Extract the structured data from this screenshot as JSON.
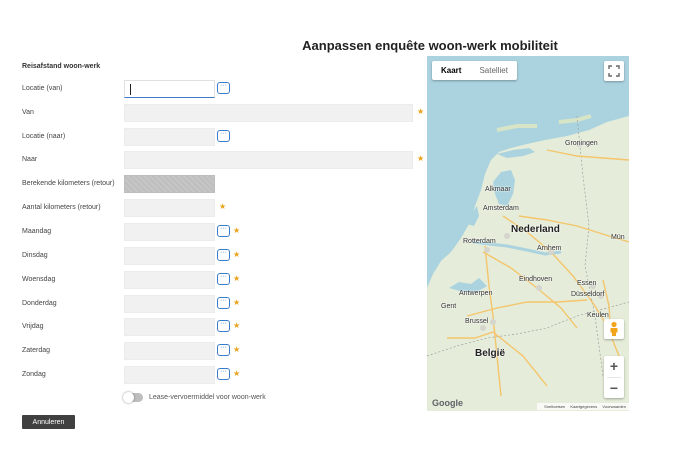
{
  "page": {
    "title": "Aanpassen enquête woon-werk mobiliteit"
  },
  "section": {
    "title": "Reisafstand woon-werk"
  },
  "colors": {
    "accent": "#3d7cc9",
    "required": "#e8a31a",
    "cancel_bg": "#404040"
  },
  "fields": {
    "locatie_van": {
      "label": "Locatie (van)",
      "value": ""
    },
    "van": {
      "label": "Van",
      "value": ""
    },
    "locatie_naar": {
      "label": "Locatie (naar)",
      "value": ""
    },
    "naar": {
      "label": "Naar",
      "value": ""
    },
    "berekende_km": {
      "label": "Berekende kilometers (retour)",
      "value": ""
    },
    "aantal_km": {
      "label": "Aantal kilometers (retour)",
      "value": ""
    },
    "maandag": {
      "label": "Maandag",
      "value": ""
    },
    "dinsdag": {
      "label": "Dinsdag",
      "value": ""
    },
    "woensdag": {
      "label": "Woensdag",
      "value": ""
    },
    "donderdag": {
      "label": "Donderdag",
      "value": ""
    },
    "vrijdag": {
      "label": "Vrijdag",
      "value": ""
    },
    "zaterdag": {
      "label": "Zaterdag",
      "value": ""
    },
    "zondag": {
      "label": "Zondag",
      "value": ""
    }
  },
  "lookup_icon": "···",
  "required_marker": "★",
  "lease": {
    "label": "Lease-vervoermiddel voor woon-werk",
    "enabled": false
  },
  "cancel_label": "Annuleren",
  "map": {
    "type_buttons": {
      "kaart": "Kaart",
      "satelliet": "Satelliet"
    },
    "selected_type": "Kaart",
    "countries": {
      "nl": "Nederland",
      "be": "België"
    },
    "cities": {
      "groningen": "Groningen",
      "alkmaar": "Alkmaar",
      "amsterdam": "Amsterdam",
      "rotterdam": "Rotterdam",
      "arnhem": "Arnhem",
      "eindhoven": "Eindhoven",
      "essen": "Essen",
      "antwerpen": "Antwerpen",
      "dusseldorf": "Düsseldorf",
      "gent": "Gent",
      "brussel": "Brussel",
      "keulen": "Keulen",
      "mun": "Mün"
    },
    "zoom_in": "+",
    "zoom_out": "−",
    "google": "Google",
    "attribution": {
      "shortcuts": "Sneltoetsen",
      "data": "Kaartgegevens",
      "terms": "Voorwaarden"
    }
  }
}
